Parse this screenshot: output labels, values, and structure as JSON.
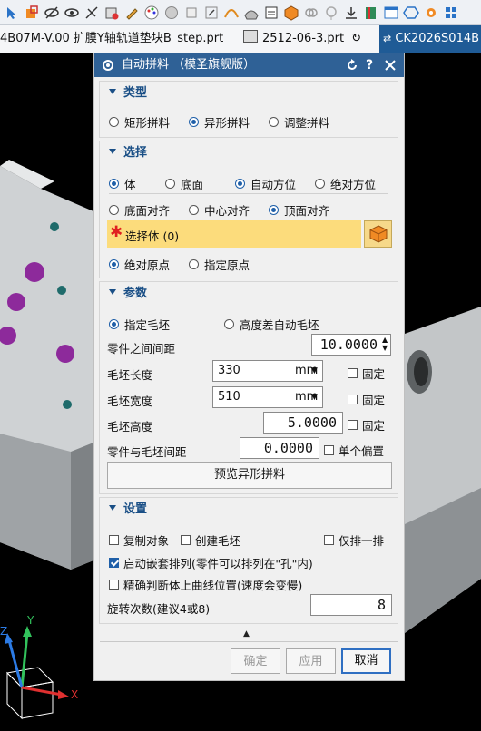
{
  "tabs": [
    {
      "label": "4B07M-V.00 扩膜Y轴轨道垫块B_step.prt"
    },
    {
      "label": "2512-06-3.prt"
    },
    {
      "label": "CK2026S014B"
    }
  ],
  "viewport": {
    "axis_x": "X",
    "axis_y": "Y",
    "axis_z": "Z"
  },
  "dialog": {
    "title": "自动拼料 （模圣旗舰版）",
    "type_section": {
      "header": "类型",
      "options": [
        "矩形拼料",
        "异形拼料",
        "调整拼料"
      ],
      "selected": "异形拼料"
    },
    "select_section": {
      "header": "选择",
      "row1": [
        "体",
        "底面",
        "自动方位",
        "绝对方位"
      ],
      "row2": [
        "底面对齐",
        "中心对齐",
        "顶面对齐"
      ],
      "select_body_label": "选择体 (0)",
      "row3": [
        "绝对原点",
        "指定原点"
      ]
    },
    "params_section": {
      "header": "参数",
      "blank_options": [
        "指定毛坯",
        "高度差自动毛坯"
      ],
      "part_spacing_label": "零件之间间距",
      "part_spacing_value": "10.0000",
      "blank_length_label": "毛坯长度",
      "blank_length_value": "330",
      "blank_length_unit": "mm",
      "blank_width_label": "毛坯宽度",
      "blank_width_value": "510",
      "blank_width_unit": "mm",
      "blank_height_label": "毛坯高度",
      "blank_height_value": "5.0000",
      "fixed_label": "固定",
      "part_blank_spacing_label": "零件与毛坯间距",
      "part_blank_spacing_value": "0.0000",
      "single_offset_label": "单个偏置",
      "preview_button": "预览异形拼料"
    },
    "settings_section": {
      "header": "设置",
      "copy_object": "复制对象",
      "create_blank": "创建毛坯",
      "single_row": "仅排一排",
      "nest_label": "启动嵌套排列(零件可以排列在\"孔\"内)",
      "precise_label": "精确判断体上曲线位置(速度会变慢)",
      "rotation_label": "旋转次数(建议4或8)",
      "rotation_value": "8"
    },
    "buttons": {
      "ok": "确定",
      "apply": "应用",
      "cancel": "取消"
    }
  }
}
